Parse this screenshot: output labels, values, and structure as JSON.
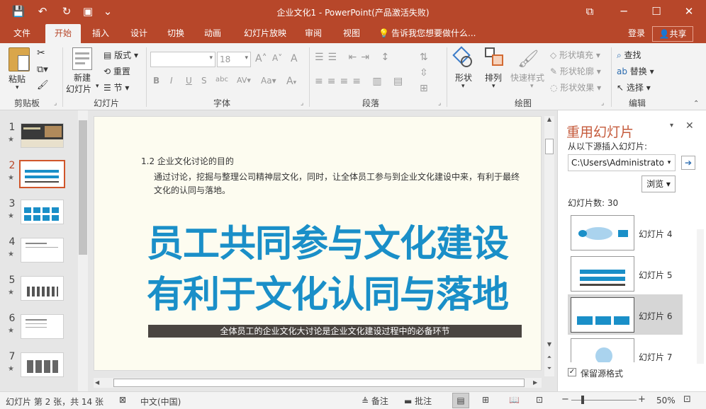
{
  "titlebar": {
    "title": "企业文化1 - PowerPoint(产品激活失败)",
    "qa": {
      "save": "💾",
      "undo": "↶",
      "redo": "↻",
      "present": "▣",
      "more": "⌄"
    },
    "win": {
      "ribbon_opts": "⧉",
      "minimize": "─",
      "maximize": "☐",
      "close": "✕"
    }
  },
  "tabs": [
    "文件",
    "开始",
    "插入",
    "设计",
    "切换",
    "动画",
    "幻灯片放映",
    "审阅",
    "视图"
  ],
  "tell_me": "告诉我您想要做什么...",
  "login": "登录",
  "share": "共享",
  "ribbon": {
    "clipboard": {
      "paste": "粘贴",
      "label": "剪贴板"
    },
    "slides": {
      "new_slide": "新建",
      "new_slide2": "幻灯片",
      "layout": "版式",
      "reset": "重置",
      "section": "节",
      "label": "幻灯片"
    },
    "font": {
      "font_size": "18",
      "bold": "B",
      "italic": "I",
      "underline": "U",
      "strike": "S",
      "shadow": "abc",
      "spacing": "AV",
      "case": "Aa",
      "grow": "A",
      "shrink": "A",
      "clear": "A",
      "color": "A",
      "label": "字体"
    },
    "paragraph": {
      "label": "段落"
    },
    "drawing": {
      "shapes": "形状",
      "arrange": "排列",
      "quick_styles": "快速样式",
      "fill": "形状填充",
      "outline": "形状轮廓",
      "effects": "形状效果",
      "label": "绘图"
    },
    "editing": {
      "find": "查找",
      "replace": "替换",
      "select": "选择",
      "label": "编辑"
    }
  },
  "thumbnails": [
    {
      "num": "1",
      "star": "★"
    },
    {
      "num": "2",
      "star": "★"
    },
    {
      "num": "3",
      "star": "★"
    },
    {
      "num": "4",
      "star": "★"
    },
    {
      "num": "5",
      "star": "★"
    },
    {
      "num": "6",
      "star": "★"
    },
    {
      "num": "7",
      "star": "★"
    }
  ],
  "slide": {
    "section": "1.2  企业文化讨论的目的",
    "body1": "通过讨论，挖掘与整理公司精神层文化，同时，让全体员工参与到企业文化建设中来，有利于最终",
    "body2": "文化的认同与落地。",
    "headline1": "员工共同参与文化建设",
    "headline2": "有利于文化认同与落地",
    "banner": "全体员工的企业文化大讨论是企业文化建设过程中的必备环节",
    "accent": "#1a8fc8"
  },
  "reuse": {
    "title": "重用幻灯片",
    "source_label": "从以下源插入幻灯片:",
    "path": "C:\\Users\\Administrato",
    "browse": "浏览",
    "count": "幻灯片数: 30",
    "items": [
      "幻灯片 4",
      "幻灯片 5",
      "幻灯片 6",
      "幻灯片 7"
    ],
    "keep_format": "保留源格式"
  },
  "status": {
    "slide_info": "幻灯片 第 2 张，共 14 张",
    "language": "中文(中国)",
    "notes": "备注",
    "comments": "批注",
    "zoom": "50%"
  }
}
